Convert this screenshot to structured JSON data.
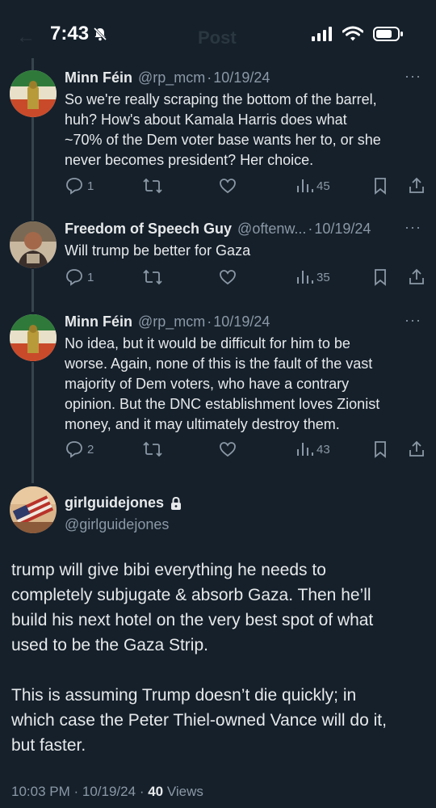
{
  "status_bar": {
    "time": "7:43"
  },
  "header": {
    "title": "Post"
  },
  "tweets": [
    {
      "name": "Minn Féin",
      "handle": "@rp_mcm",
      "date": "10/19/24",
      "lines": [
        "So we're really scraping the bottom of the barrel,",
        "huh? How's about Kamala Harris does what",
        "~70% of the Dem voter base wants her to, or she",
        "never becomes president? Her choice."
      ],
      "replies": "1",
      "retweets": "",
      "likes": "",
      "views": "45"
    },
    {
      "name": "Freedom of Speech Guy",
      "handle": "@oftenw...",
      "date": "10/19/24",
      "lines": [
        "Will trump be better for Gaza"
      ],
      "replies": "1",
      "retweets": "",
      "likes": "",
      "views": "35"
    },
    {
      "name": "Minn Féin",
      "handle": "@rp_mcm",
      "date": "10/19/24",
      "lines": [
        "No idea, but it would be difficult for him to be",
        "worse. Again, none of this is the fault of the vast",
        "majority of Dem voters, who have a contrary",
        "opinion. But the DNC establishment loves Zionist",
        "money, and it may ultimately destroy them."
      ],
      "replies": "2",
      "retweets": "",
      "likes": "",
      "views": "43"
    }
  ],
  "main_post": {
    "name": "girlguidejones",
    "handle": "@girlguidejones",
    "paragraphs": [
      [
        "trump will give bibi everything he needs to",
        "completely subjugate & absorb Gaza. Then he’ll",
        "build his next hotel on the very best spot of what",
        "used to be the Gaza Strip."
      ],
      [
        "This is assuming Trump doesn’t die quickly; in",
        "which case the Peter Thiel-owned Vance will do it,",
        "but faster."
      ]
    ],
    "time": "10:03 PM",
    "date": "10/19/24",
    "views_count": "40",
    "views_label": "Views"
  },
  "colors": {
    "background": "#15202b",
    "text": "#e7e9ea",
    "secondary": "#8b98a5",
    "thread_line": "#38444d"
  }
}
